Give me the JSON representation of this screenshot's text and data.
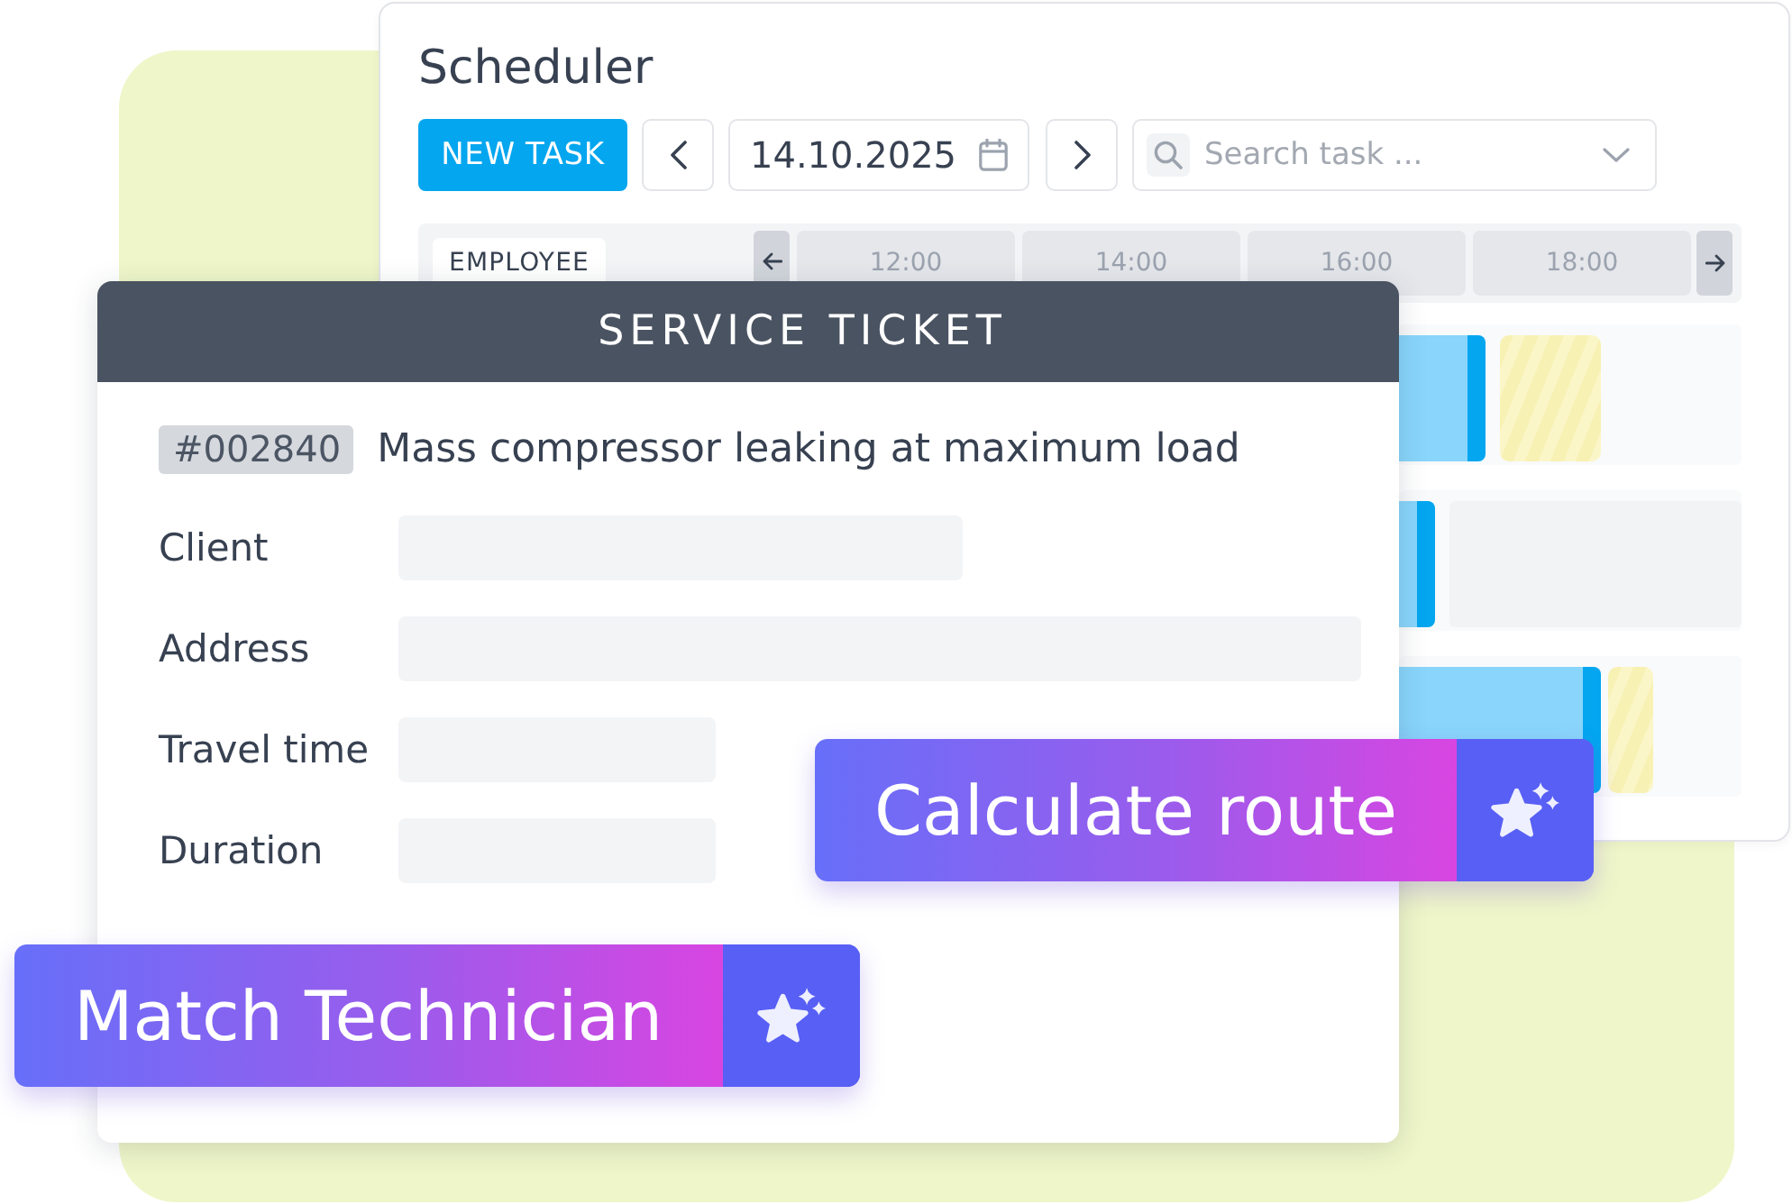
{
  "scheduler": {
    "title": "Scheduler",
    "new_task_button": "NEW TASK",
    "date": "14.10.2025",
    "search": {
      "placeholder": "Search task ..."
    },
    "timeline": {
      "employee_header": "EMPLOYEE",
      "time_slots": [
        "12:00",
        "14:00",
        "16:00",
        "18:00"
      ],
      "rows": [
        {
          "events": [
            {
              "kind": "task"
            },
            {
              "kind": "hatched"
            }
          ]
        },
        {
          "events": [
            {
              "kind": "task"
            },
            {
              "kind": "blocked"
            }
          ]
        },
        {
          "events": [
            {
              "kind": "task"
            },
            {
              "kind": "hatched"
            }
          ]
        }
      ]
    }
  },
  "service_ticket": {
    "title": "SERVICE TICKET",
    "ticket_number": "#002840",
    "summary": "Mass compressor leaking at maximum load",
    "fields": [
      {
        "label": "Client"
      },
      {
        "label": "Address"
      },
      {
        "label": "Travel time"
      },
      {
        "label": "Duration"
      }
    ]
  },
  "actions": [
    {
      "label": "Calculate route"
    },
    {
      "label": "Match Technician"
    }
  ]
}
